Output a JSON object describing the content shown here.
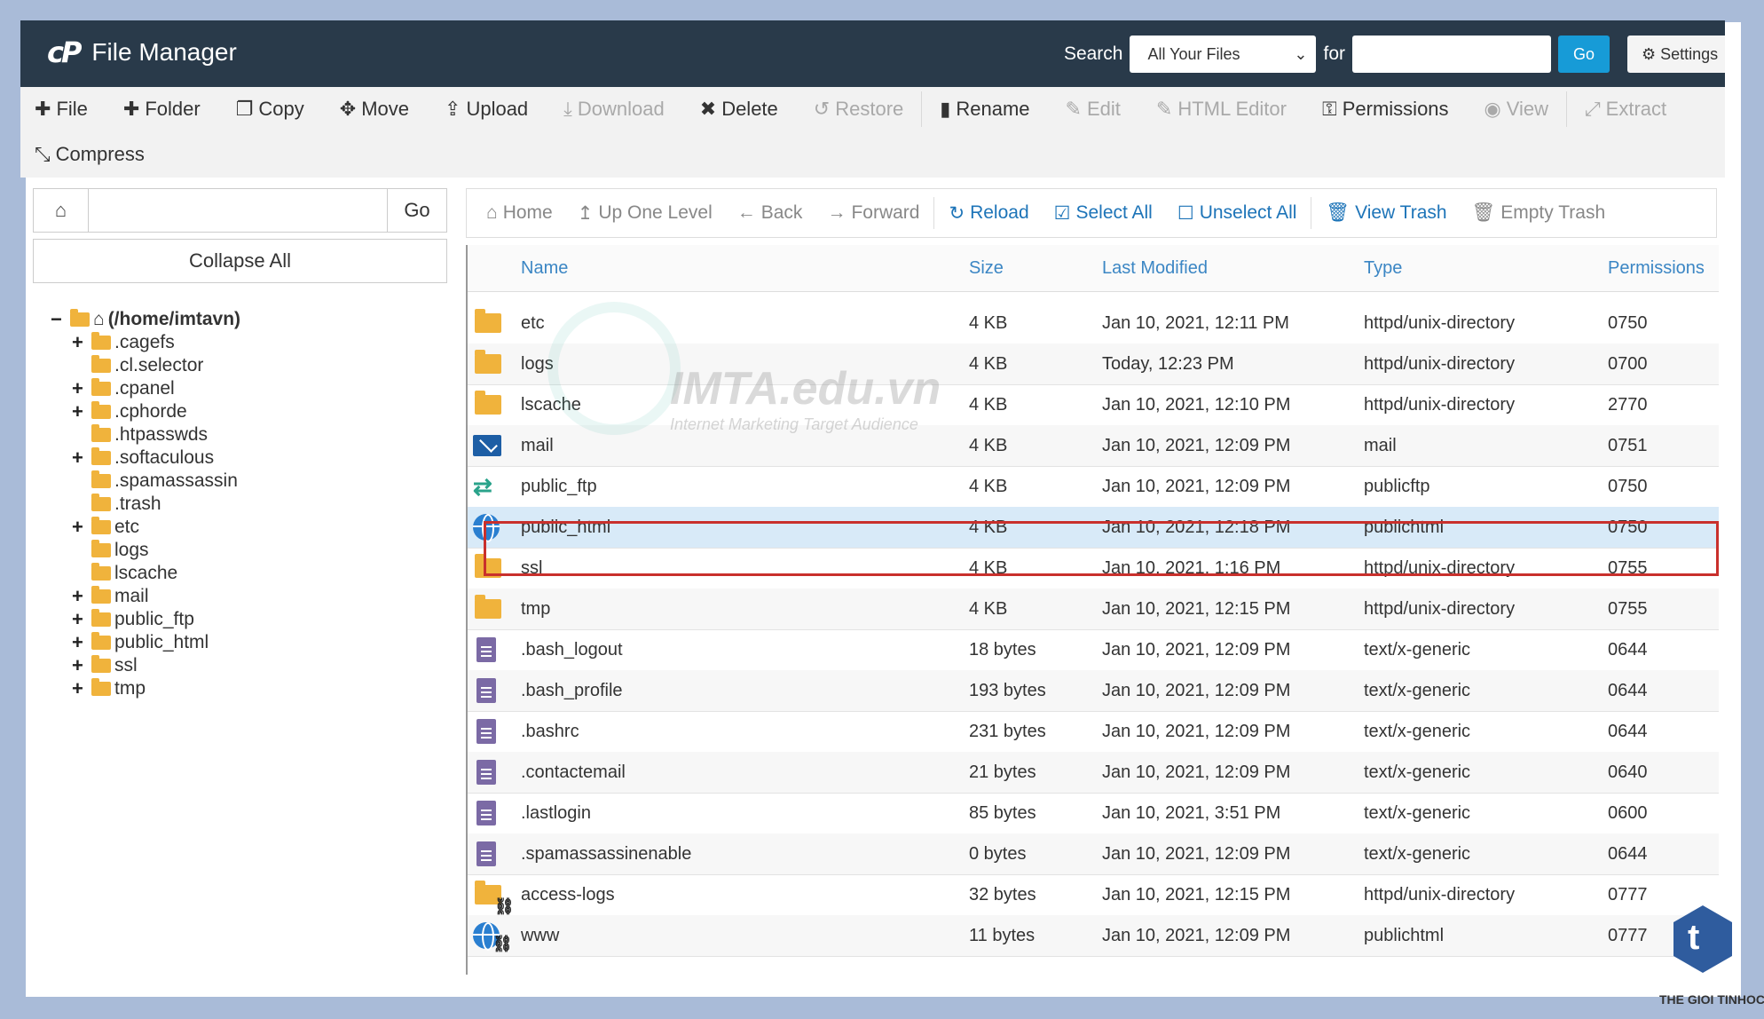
{
  "topbar": {
    "brand_logo": "cP",
    "title": "File Manager",
    "search_label": "Search",
    "search_scope": "All Your Files",
    "for_label": "for",
    "go_label": "Go",
    "settings_label": "Settings"
  },
  "toolbar": {
    "row1": [
      {
        "name": "file",
        "icon": "plus-icon",
        "glyph": "✚",
        "label": "File",
        "disabled": false
      },
      {
        "name": "folder",
        "icon": "plus-icon",
        "glyph": "✚",
        "label": "Folder",
        "disabled": false
      },
      {
        "name": "copy",
        "icon": "copy-icon",
        "glyph": "❐",
        "label": "Copy",
        "disabled": false
      },
      {
        "name": "move",
        "icon": "move-icon",
        "glyph": "✥",
        "label": "Move",
        "disabled": false
      },
      {
        "name": "upload",
        "icon": "upload-icon",
        "glyph": "⇪",
        "label": "Upload",
        "disabled": false
      },
      {
        "name": "download",
        "icon": "download-icon",
        "glyph": "⤓",
        "label": "Download",
        "disabled": true
      },
      {
        "name": "delete",
        "icon": "times-icon",
        "glyph": "✖",
        "label": "Delete",
        "disabled": false
      },
      {
        "name": "restore",
        "icon": "undo-icon",
        "glyph": "↺",
        "label": "Restore",
        "disabled": true
      },
      {
        "name": "rename",
        "icon": "file-icon",
        "glyph": "▮",
        "label": "Rename",
        "disabled": false
      },
      {
        "name": "edit",
        "icon": "pencil-icon",
        "glyph": "✎",
        "label": "Edit",
        "disabled": true
      },
      {
        "name": "html-editor",
        "icon": "edit-icon",
        "glyph": "✎",
        "label": "HTML Editor",
        "disabled": true
      },
      {
        "name": "permissions",
        "icon": "key-icon",
        "glyph": "⚿",
        "label": "Permissions",
        "disabled": false
      },
      {
        "name": "view",
        "icon": "eye-icon",
        "glyph": "◉",
        "label": "View",
        "disabled": true
      },
      {
        "name": "extract",
        "icon": "expand-icon",
        "glyph": "⤢",
        "label": "Extract",
        "disabled": true
      }
    ],
    "compress": {
      "icon": "compress-icon",
      "glyph": "⤡",
      "label": "Compress"
    }
  },
  "left": {
    "go_label": "Go",
    "collapse_label": "Collapse All",
    "tree": [
      {
        "label": "(/home/imtavn)",
        "level": 0,
        "toggle": "−",
        "root": true
      },
      {
        "label": ".cagefs",
        "level": 1,
        "toggle": "+"
      },
      {
        "label": ".cl.selector",
        "level": 1,
        "toggle": ""
      },
      {
        "label": ".cpanel",
        "level": 1,
        "toggle": "+"
      },
      {
        "label": ".cphorde",
        "level": 1,
        "toggle": "+"
      },
      {
        "label": ".htpasswds",
        "level": 1,
        "toggle": ""
      },
      {
        "label": ".softaculous",
        "level": 1,
        "toggle": "+"
      },
      {
        "label": ".spamassassin",
        "level": 1,
        "toggle": ""
      },
      {
        "label": ".trash",
        "level": 1,
        "toggle": ""
      },
      {
        "label": "etc",
        "level": 1,
        "toggle": "+"
      },
      {
        "label": "logs",
        "level": 1,
        "toggle": ""
      },
      {
        "label": "lscache",
        "level": 1,
        "toggle": ""
      },
      {
        "label": "mail",
        "level": 1,
        "toggle": "+"
      },
      {
        "label": "public_ftp",
        "level": 1,
        "toggle": "+"
      },
      {
        "label": "public_html",
        "level": 1,
        "toggle": "+"
      },
      {
        "label": "ssl",
        "level": 1,
        "toggle": "+"
      },
      {
        "label": "tmp",
        "level": 1,
        "toggle": "+"
      }
    ]
  },
  "nav": [
    {
      "name": "home",
      "glyph": "⌂",
      "label": "Home",
      "style": "grey"
    },
    {
      "name": "up-one-level",
      "glyph": "↥",
      "label": "Up One Level",
      "style": "grey"
    },
    {
      "name": "back",
      "glyph": "←",
      "label": "Back",
      "style": "grey"
    },
    {
      "name": "forward",
      "glyph": "→",
      "label": "Forward",
      "style": "grey"
    },
    {
      "name": "reload",
      "glyph": "↻",
      "label": "Reload",
      "style": "blue"
    },
    {
      "name": "select-all",
      "glyph": "☑",
      "label": "Select All",
      "style": "blue"
    },
    {
      "name": "unselect-all",
      "glyph": "☐",
      "label": "Unselect All",
      "style": "blue"
    },
    {
      "name": "view-trash",
      "glyph": "🗑",
      "label": "View Trash",
      "style": "blue"
    },
    {
      "name": "empty-trash",
      "glyph": "🗑",
      "label": "Empty Trash",
      "style": "grey"
    }
  ],
  "table": {
    "columns": [
      "Name",
      "Size",
      "Last Modified",
      "Type",
      "Permissions"
    ],
    "rows": [
      {
        "icon": "folder",
        "name": "etc",
        "size": "4 KB",
        "modified": "Jan 10, 2021, 12:11 PM",
        "type": "httpd/unix-directory",
        "perms": "0750"
      },
      {
        "icon": "folder",
        "name": "logs",
        "size": "4 KB",
        "modified": "Today, 12:23 PM",
        "type": "httpd/unix-directory",
        "perms": "0700"
      },
      {
        "icon": "folder",
        "name": "lscache",
        "size": "4 KB",
        "modified": "Jan 10, 2021, 12:10 PM",
        "type": "httpd/unix-directory",
        "perms": "2770"
      },
      {
        "icon": "mail",
        "name": "mail",
        "size": "4 KB",
        "modified": "Jan 10, 2021, 12:09 PM",
        "type": "mail",
        "perms": "0751"
      },
      {
        "icon": "ftp",
        "name": "public_ftp",
        "size": "4 KB",
        "modified": "Jan 10, 2021, 12:09 PM",
        "type": "publicftp",
        "perms": "0750"
      },
      {
        "icon": "globe",
        "name": "public_html",
        "size": "4 KB",
        "modified": "Jan 10, 2021, 12:18 PM",
        "type": "publichtml",
        "perms": "0750",
        "selected": true
      },
      {
        "icon": "folder",
        "name": "ssl",
        "size": "4 KB",
        "modified": "Jan 10, 2021, 1:16 PM",
        "type": "httpd/unix-directory",
        "perms": "0755"
      },
      {
        "icon": "folder",
        "name": "tmp",
        "size": "4 KB",
        "modified": "Jan 10, 2021, 12:15 PM",
        "type": "httpd/unix-directory",
        "perms": "0755"
      },
      {
        "icon": "file",
        "name": ".bash_logout",
        "size": "18 bytes",
        "modified": "Jan 10, 2021, 12:09 PM",
        "type": "text/x-generic",
        "perms": "0644"
      },
      {
        "icon": "file",
        "name": ".bash_profile",
        "size": "193 bytes",
        "modified": "Jan 10, 2021, 12:09 PM",
        "type": "text/x-generic",
        "perms": "0644"
      },
      {
        "icon": "file",
        "name": ".bashrc",
        "size": "231 bytes",
        "modified": "Jan 10, 2021, 12:09 PM",
        "type": "text/x-generic",
        "perms": "0644"
      },
      {
        "icon": "file",
        "name": ".contactemail",
        "size": "21 bytes",
        "modified": "Jan 10, 2021, 12:09 PM",
        "type": "text/x-generic",
        "perms": "0640"
      },
      {
        "icon": "file",
        "name": ".lastlogin",
        "size": "85 bytes",
        "modified": "Jan 10, 2021, 3:51 PM",
        "type": "text/x-generic",
        "perms": "0600"
      },
      {
        "icon": "file",
        "name": ".spamassassinenable",
        "size": "0 bytes",
        "modified": "Jan 10, 2021, 12:09 PM",
        "type": "text/x-generic",
        "perms": "0644"
      },
      {
        "icon": "folder-link",
        "name": "access-logs",
        "size": "32 bytes",
        "modified": "Jan 10, 2021, 12:15 PM",
        "type": "httpd/unix-directory",
        "perms": "0777"
      },
      {
        "icon": "globe-link",
        "name": "www",
        "size": "11 bytes",
        "modified": "Jan 10, 2021, 12:09 PM",
        "type": "publichtml",
        "perms": "0777"
      }
    ]
  },
  "watermark": {
    "title": "IMTA.edu.vn",
    "subtitle": "Internet Marketing Target Audience"
  },
  "corner_badge": {
    "letter": "t",
    "text": "THE GIOI TINHOC"
  },
  "colors": {
    "topbar": "#293a4a",
    "accent": "#179bd7",
    "link": "#3b86c4",
    "selected_row": "#d8eaf8",
    "highlight_frame": "#c9302c",
    "folder": "#f0b33c"
  }
}
